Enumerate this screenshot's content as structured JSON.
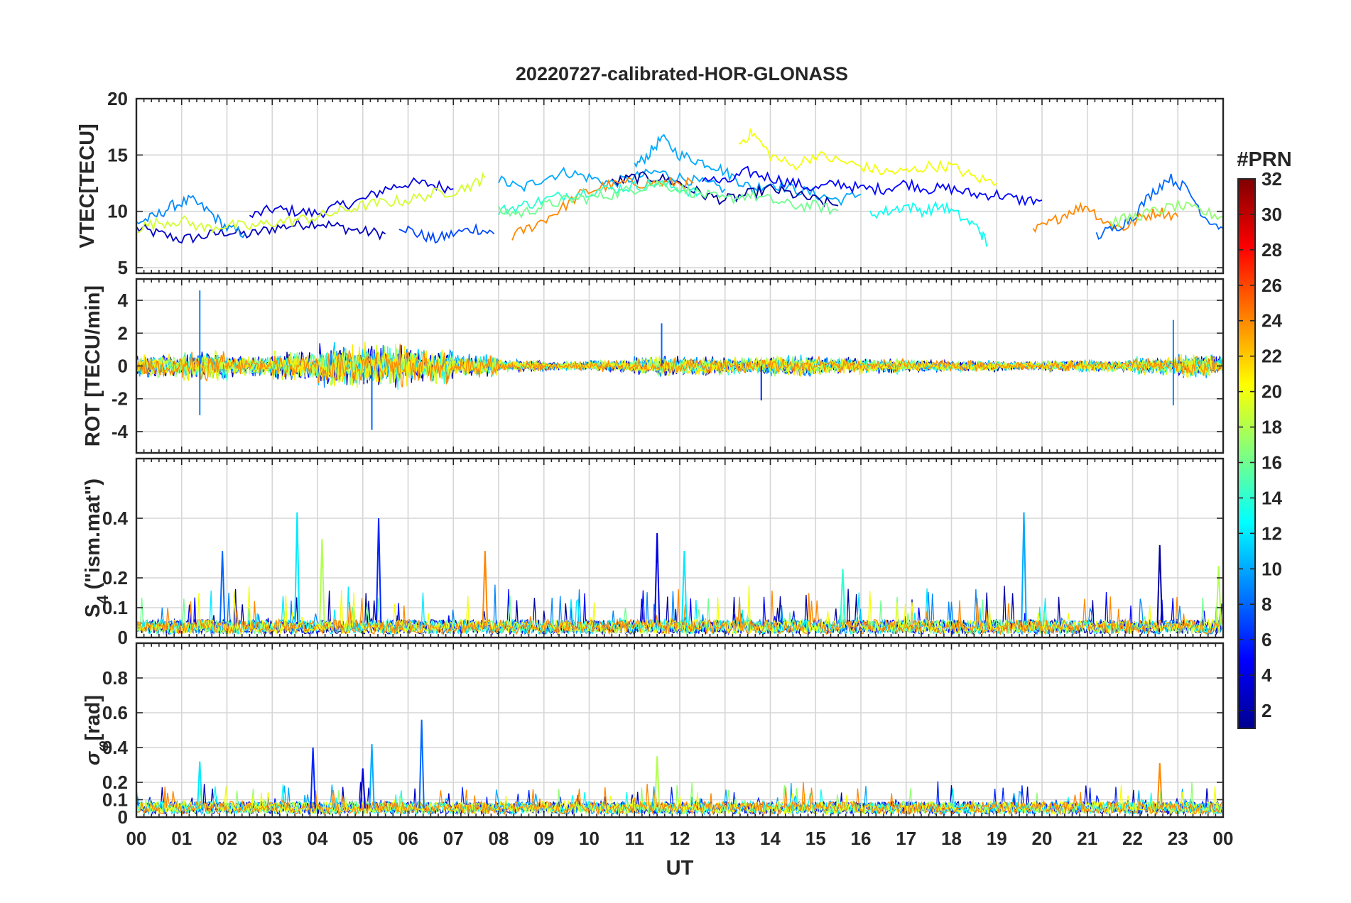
{
  "figure": {
    "title": "20220727-calibrated-HOR-GLONASS",
    "xlabel": "UT",
    "x_ticks": [
      "00",
      "01",
      "02",
      "03",
      "04",
      "05",
      "06",
      "07",
      "08",
      "09",
      "10",
      "11",
      "12",
      "13",
      "14",
      "15",
      "16",
      "17",
      "18",
      "19",
      "20",
      "21",
      "22",
      "23",
      "00"
    ],
    "line_colormap": "jet"
  },
  "colorbar": {
    "title": "#PRN",
    "range": [
      1,
      32
    ],
    "ticks": [
      "2",
      "4",
      "6",
      "8",
      "10",
      "12",
      "14",
      "16",
      "18",
      "20",
      "22",
      "24",
      "26",
      "28",
      "30",
      "32"
    ],
    "colormap": "jet"
  },
  "panels": [
    {
      "key": "vtec",
      "ylabel": "VTEC[TECU]",
      "ylim": [
        4.5,
        20
      ],
      "yticks": [
        "5",
        "10",
        "15",
        "20"
      ]
    },
    {
      "key": "rot",
      "ylabel": "ROT [TECU/min]",
      "ylim": [
        -5.3,
        5.3
      ],
      "yticks": [
        "-4",
        "-2",
        "0",
        "2",
        "4"
      ]
    },
    {
      "key": "s4",
      "ylabel": "S4 (\"ism.mat\")",
      "ylabel_main": "S",
      "ylabel_sub": "4",
      "ylabel_rest": " (\"ism.mat\")",
      "ylim": [
        0,
        0.6
      ],
      "yticks": [
        "0",
        "0.1",
        "0.2",
        "0.4"
      ]
    },
    {
      "key": "sigma",
      "ylabel": "σφ[rad]",
      "ylabel_main": "σ",
      "ylabel_sub": "φ",
      "ylabel_rest": "[rad]",
      "ylim": [
        0,
        1
      ],
      "yticks": [
        "0",
        "0.1",
        "0.2",
        "0.4",
        "0.6",
        "0.8"
      ]
    }
  ],
  "chart_data": [
    {
      "type": "line",
      "title": "20220727-calibrated-HOR-GLONASS",
      "ylabel": "VTEC[TECU]",
      "xlabel": "",
      "ylim": [
        4.5,
        20
      ],
      "grid": true,
      "note_series": "approximate sampled traces per satellite PRN; x in hours UT",
      "series": [
        {
          "prn": 3,
          "x": [
            0,
            0.5,
            1,
            1.5,
            2,
            2.5,
            3,
            3.5,
            4,
            4.5,
            5,
            5.5
          ],
          "y": [
            8.5,
            8.0,
            7.5,
            7.8,
            8.2,
            7.9,
            8.5,
            8.8,
            9.0,
            8.6,
            8.2,
            8.0
          ]
        },
        {
          "prn": 4,
          "x": [
            2.5,
            3,
            3.5,
            4,
            4.5,
            5,
            5.5,
            6,
            6.5,
            7
          ],
          "y": [
            9.5,
            10.2,
            10.0,
            9.8,
            10.5,
            11.0,
            12.0,
            12.5,
            12.4,
            12.0
          ]
        },
        {
          "prn": 7,
          "x": [
            5.8,
            6.2,
            6.6,
            7,
            7.5,
            7.9
          ],
          "y": [
            8.8,
            8.0,
            7.5,
            8.0,
            8.5,
            8.0
          ]
        },
        {
          "prn": 9,
          "x": [
            0,
            0.4,
            0.8,
            1.2,
            1.6,
            2,
            2.4
          ],
          "y": [
            9.0,
            9.5,
            10.5,
            11.0,
            10.0,
            8.5,
            8.0
          ]
        },
        {
          "prn": 10,
          "x": [
            8,
            8.5,
            9,
            9.5,
            10,
            10.5,
            11,
            11.5,
            12,
            12.5,
            13
          ],
          "y": [
            12.8,
            12.0,
            13.0,
            13.5,
            13.0,
            12.5,
            13.0,
            13.5,
            13.0,
            12.5,
            12.0
          ]
        },
        {
          "prn": 10,
          "x": [
            11,
            11.3,
            11.6,
            12,
            12.4,
            12.8,
            13.2,
            13.6,
            14,
            14.5,
            15,
            15.5,
            16
          ],
          "y": [
            14.0,
            15.0,
            16.5,
            15.0,
            14.5,
            14.0,
            13.0,
            12.0,
            12.5,
            12.0,
            11.5,
            11.0,
            11.5
          ]
        },
        {
          "prn": 5,
          "x": [
            12.5,
            13,
            13.5,
            14,
            14.5,
            15,
            15.5,
            16,
            16.5,
            17,
            17.5,
            18,
            18.5,
            19,
            19.5,
            20
          ],
          "y": [
            13.0,
            12.5,
            13.5,
            13.0,
            12.5,
            12.0,
            12.5,
            12.0,
            12.0,
            12.5,
            12.0,
            12.0,
            11.5,
            11.5,
            11.0,
            11.0
          ]
        },
        {
          "prn": 2,
          "x": [
            10.5,
            11,
            11.5,
            12,
            12.5,
            13,
            13.5,
            14,
            14.5,
            15,
            15.5
          ],
          "y": [
            12.5,
            13.0,
            13.0,
            12.5,
            11.5,
            11.0,
            11.5,
            12.0,
            11.5,
            11.0,
            10.5
          ]
        },
        {
          "prn": 24,
          "x": [
            8.3,
            8.8,
            9.3,
            9.8,
            10.3,
            10.8,
            11.3,
            11.8,
            12.3
          ],
          "y": [
            7.8,
            8.8,
            10.0,
            11.5,
            12.2,
            12.5,
            12.5,
            12.5,
            12.5
          ]
        },
        {
          "prn": 24,
          "x": [
            19.8,
            20.2,
            20.6,
            21,
            21.4,
            21.8,
            22.2,
            22.6,
            23
          ],
          "y": [
            8.2,
            9.0,
            10.0,
            10.5,
            9.0,
            8.5,
            9.5,
            10.0,
            9.5
          ]
        },
        {
          "prn": 14,
          "x": [
            8,
            8.5,
            9,
            9.5,
            10,
            10.5,
            11,
            11.5,
            12,
            12.5
          ],
          "y": [
            10.0,
            10.5,
            11.0,
            11.5,
            11.8,
            12.0,
            12.2,
            12.5,
            12.0,
            11.5
          ]
        },
        {
          "prn": 16,
          "x": [
            8,
            8.5,
            9,
            9.5,
            10,
            10.5,
            11,
            11.5,
            12,
            12.5,
            13,
            13.5,
            14,
            14.5,
            15,
            15.5
          ],
          "y": [
            10.0,
            9.8,
            10.5,
            11.0,
            11.2,
            11.5,
            12.0,
            12.5,
            12.0,
            11.5,
            11.0,
            11.5,
            11.0,
            10.5,
            10.5,
            10.0
          ]
        },
        {
          "prn": 20,
          "x": [
            13.3,
            13.6,
            14,
            14.5,
            15,
            15.5,
            16,
            16.5,
            17,
            17.5,
            18,
            18.5,
            19
          ],
          "y": [
            16.0,
            17.0,
            15.0,
            14.0,
            15.0,
            14.5,
            14.0,
            13.5,
            13.5,
            14.0,
            14.0,
            13.0,
            12.5
          ]
        },
        {
          "prn": 19,
          "x": [
            0,
            0.5,
            1,
            1.5,
            2,
            2.5,
            3,
            3.5,
            4,
            4.5,
            5,
            5.5,
            6,
            6.5,
            7,
            7.5,
            7.7
          ],
          "y": [
            8.5,
            9.0,
            9.2,
            8.5,
            8.8,
            8.6,
            9.0,
            9.2,
            9.5,
            10.0,
            10.5,
            10.8,
            11.0,
            11.5,
            11.8,
            12.5,
            13.0
          ]
        },
        {
          "prn": 13,
          "x": [
            16.2,
            16.6,
            17,
            17.4,
            17.8,
            18.2,
            18.6,
            18.8
          ],
          "y": [
            9.8,
            10.0,
            10.5,
            10.0,
            10.5,
            9.5,
            8.5,
            7.0
          ]
        },
        {
          "prn": 8,
          "x": [
            21.2,
            21.6,
            22,
            22.4,
            22.8,
            23.2,
            23.6,
            24
          ],
          "y": [
            7.8,
            8.5,
            9.5,
            11.5,
            13.0,
            12.0,
            9.5,
            8.5
          ]
        },
        {
          "prn": 17,
          "x": [
            21.5,
            22,
            22.5,
            23,
            23.5,
            24
          ],
          "y": [
            9.0,
            9.5,
            10.0,
            10.5,
            10.0,
            9.5
          ]
        }
      ]
    },
    {
      "type": "line",
      "ylabel": "ROT [TECU/min]",
      "ylim": [
        -5.3,
        5.3
      ],
      "grid": true,
      "note_series": "noisy rate-of-TEC traces centered at 0; envelope amplitude per hour (TECU/min)",
      "envelope_hours": [
        0,
        1,
        2,
        3,
        4,
        5,
        6,
        7,
        8,
        9,
        10,
        11,
        12,
        13,
        14,
        15,
        16,
        17,
        18,
        19,
        20,
        21,
        22,
        23
      ],
      "envelope_amp": [
        0.8,
        1.0,
        0.7,
        1.0,
        1.5,
        1.5,
        1.2,
        0.8,
        0.4,
        0.3,
        0.4,
        0.7,
        0.6,
        0.6,
        0.7,
        0.6,
        0.5,
        0.4,
        0.4,
        0.3,
        0.4,
        0.4,
        0.6,
        0.8
      ],
      "peaks": [
        {
          "x": 1.4,
          "y": 4.6
        },
        {
          "x": 1.4,
          "y": -3.0
        },
        {
          "x": 5.2,
          "y": -3.9
        },
        {
          "x": 11.6,
          "y": 2.6
        },
        {
          "x": 13.8,
          "y": -2.1
        },
        {
          "x": 22.9,
          "y": 2.8
        },
        {
          "x": 22.9,
          "y": -2.4
        }
      ]
    },
    {
      "type": "line",
      "ylabel": "S4 (\"ism.mat\")",
      "ylim": [
        0,
        0.6
      ],
      "grid": true,
      "note_series": "amplitude scintillation index; baseline ~0.05 with spikes",
      "peaks": [
        {
          "x": 3.55,
          "y": 0.42
        },
        {
          "x": 5.35,
          "y": 0.4
        },
        {
          "x": 19.6,
          "y": 0.42
        },
        {
          "x": 1.9,
          "y": 0.29
        },
        {
          "x": 4.1,
          "y": 0.33
        },
        {
          "x": 7.7,
          "y": 0.29
        },
        {
          "x": 11.5,
          "y": 0.35
        },
        {
          "x": 12.1,
          "y": 0.29
        },
        {
          "x": 22.6,
          "y": 0.31
        },
        {
          "x": 15.6,
          "y": 0.23
        },
        {
          "x": 23.9,
          "y": 0.24
        }
      ]
    },
    {
      "type": "line",
      "ylabel": "σφ[rad]",
      "ylim": [
        0,
        1
      ],
      "grid": true,
      "note_series": "phase scintillation index; baseline ~0.05 with spikes",
      "peaks": [
        {
          "x": 1.4,
          "y": 0.32
        },
        {
          "x": 3.9,
          "y": 0.4
        },
        {
          "x": 5.2,
          "y": 0.42
        },
        {
          "x": 6.3,
          "y": 0.56
        },
        {
          "x": 11.5,
          "y": 0.35
        },
        {
          "x": 22.6,
          "y": 0.31
        },
        {
          "x": 5.0,
          "y": 0.28
        }
      ]
    }
  ]
}
